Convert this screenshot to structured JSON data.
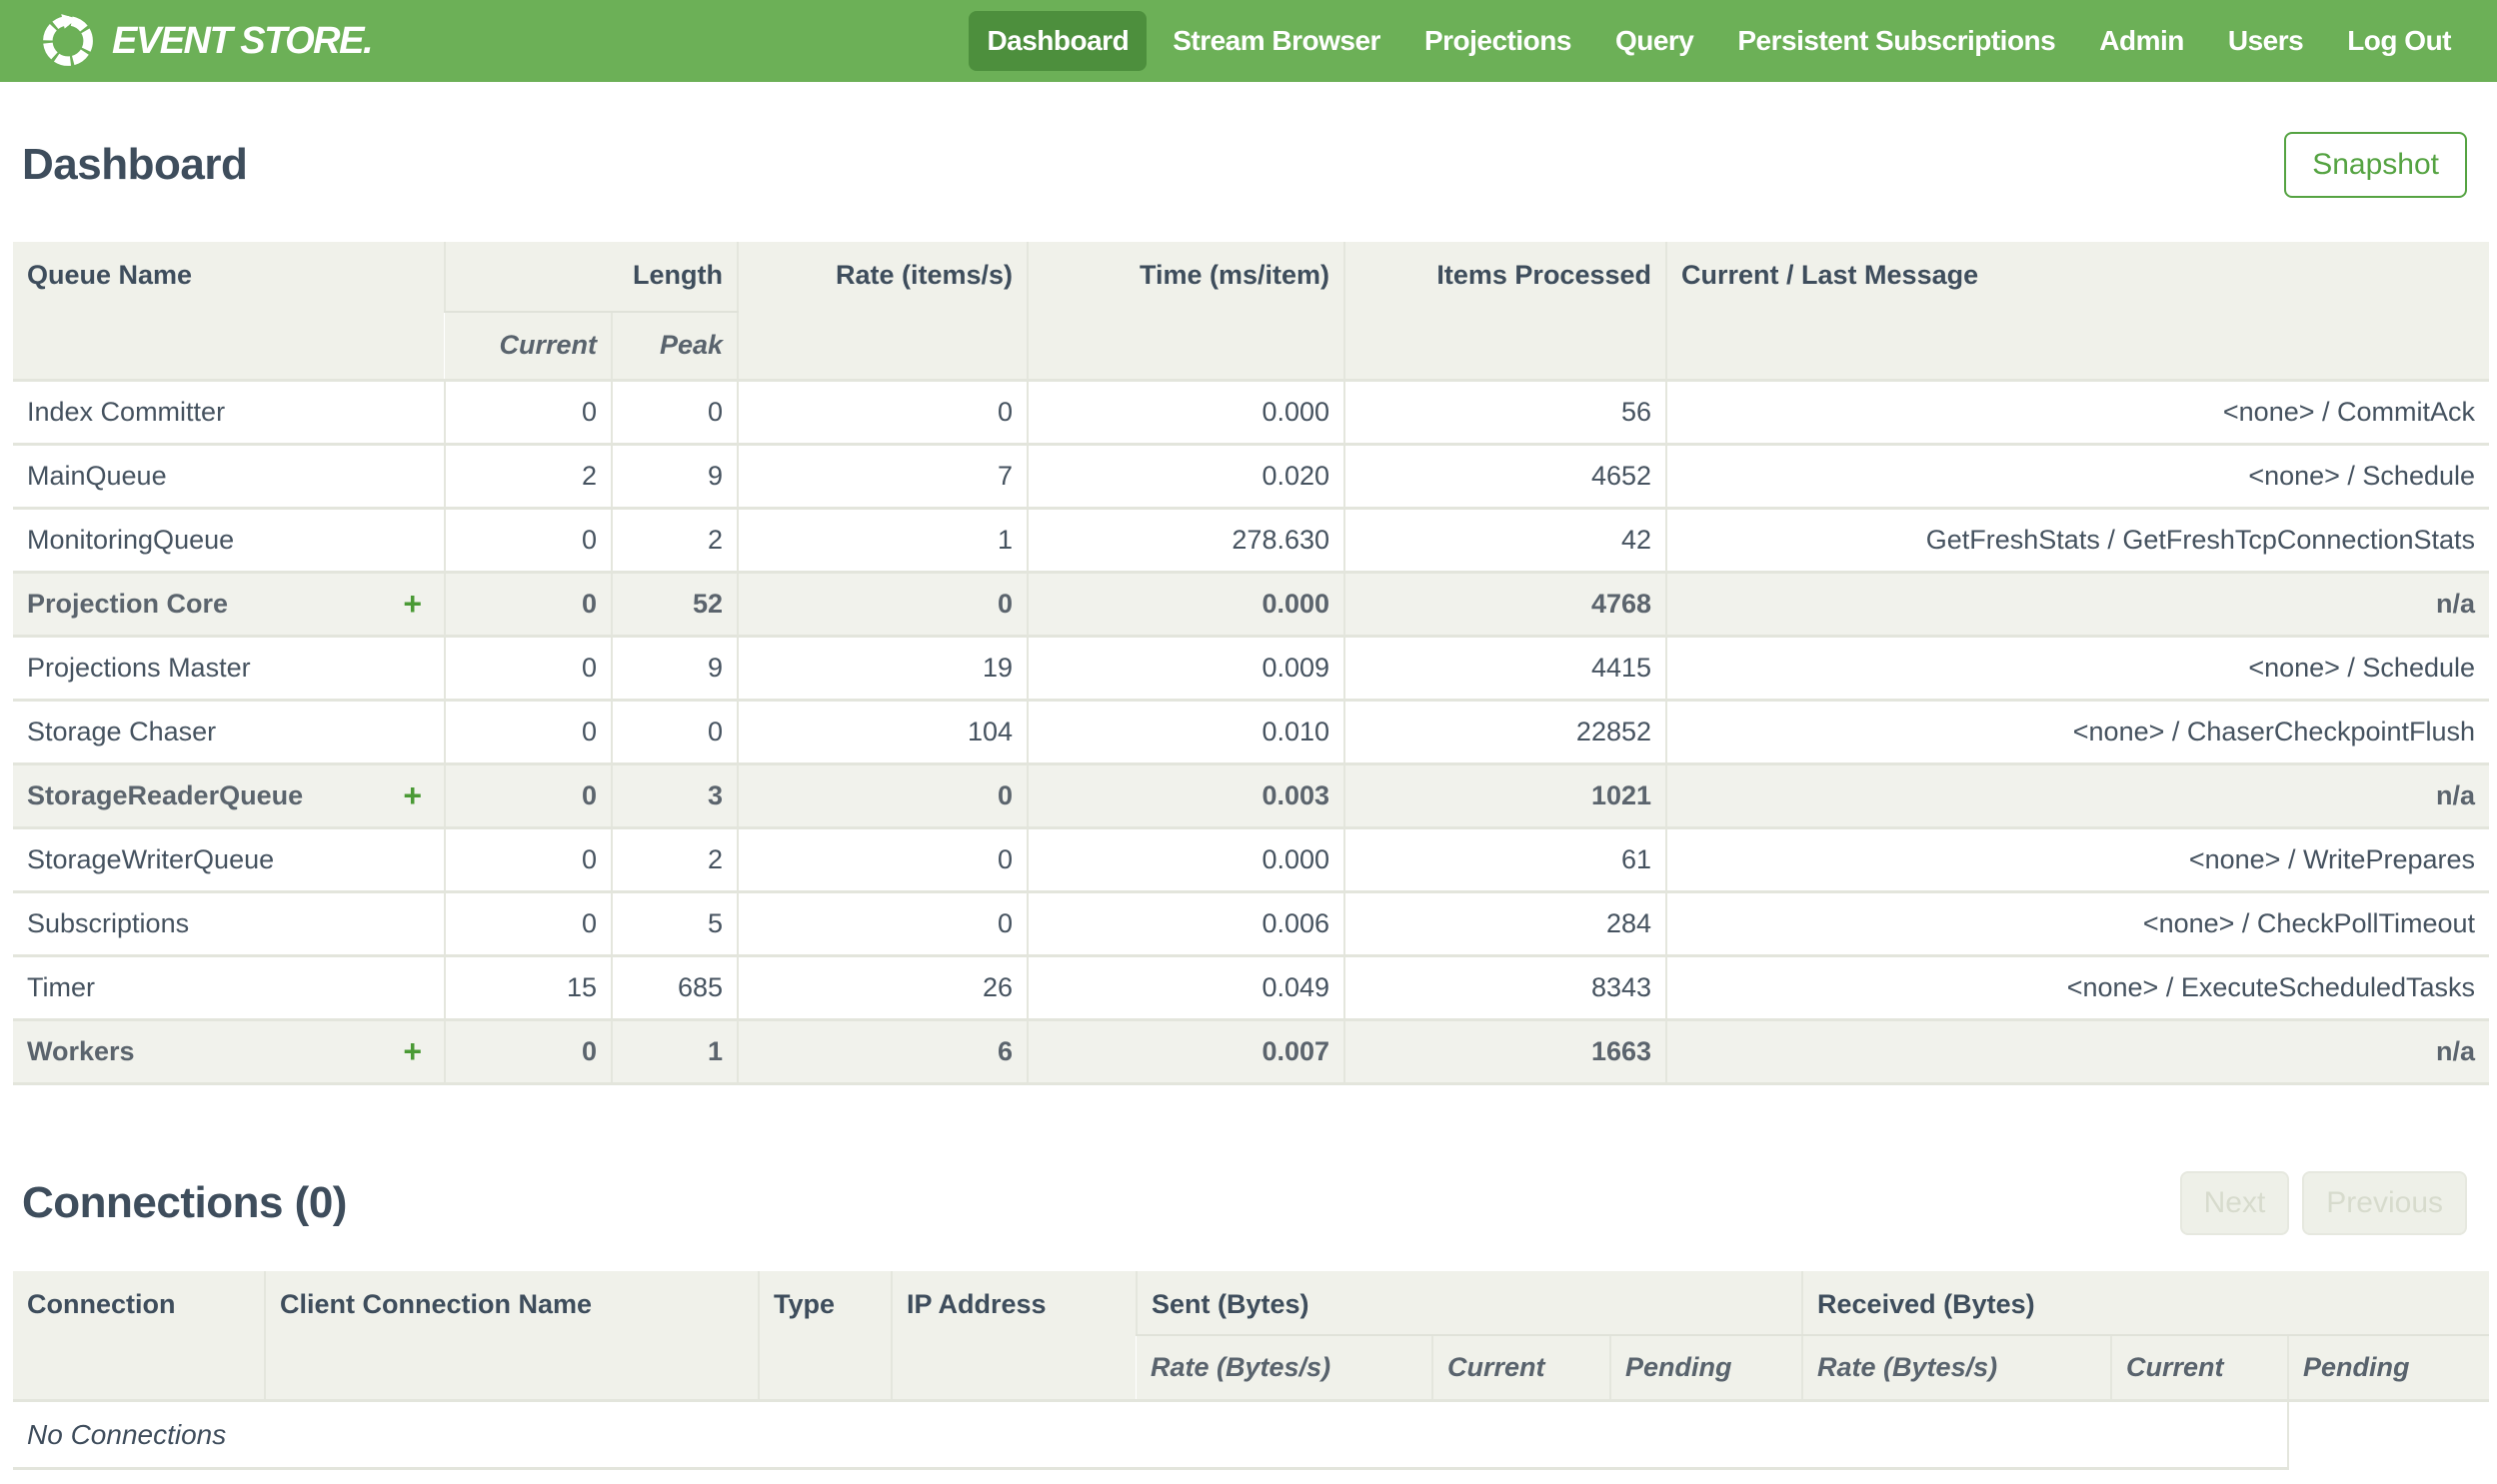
{
  "nav": {
    "brand": "EVENT STORE.",
    "items": [
      {
        "label": "Dashboard",
        "active": true
      },
      {
        "label": "Stream Browser",
        "active": false
      },
      {
        "label": "Projections",
        "active": false
      },
      {
        "label": "Query",
        "active": false
      },
      {
        "label": "Persistent Subscriptions",
        "active": false
      },
      {
        "label": "Admin",
        "active": false
      },
      {
        "label": "Users",
        "active": false
      },
      {
        "label": "Log Out",
        "active": false
      }
    ]
  },
  "header": {
    "title": "Dashboard",
    "snapshot_button": "Snapshot"
  },
  "queues_table": {
    "columns": {
      "queue_name": "Queue Name",
      "length": "Length",
      "current": "Current",
      "peak": "Peak",
      "rate": "Rate (items/s)",
      "time": "Time (ms/item)",
      "items_processed": "Items Processed",
      "message": "Current / Last Message"
    },
    "expand_icon": "+",
    "rows": [
      {
        "name": "Index Committer",
        "group": false,
        "current": "0",
        "peak": "0",
        "rate": "0",
        "time": "0.000",
        "processed": "56",
        "message": "<none> / CommitAck"
      },
      {
        "name": "MainQueue",
        "group": false,
        "current": "2",
        "peak": "9",
        "rate": "7",
        "time": "0.020",
        "processed": "4652",
        "message": "<none> / Schedule"
      },
      {
        "name": "MonitoringQueue",
        "group": false,
        "current": "0",
        "peak": "2",
        "rate": "1",
        "time": "278.630",
        "processed": "42",
        "message": "GetFreshStats / GetFreshTcpConnectionStats"
      },
      {
        "name": "Projection Core",
        "group": true,
        "current": "0",
        "peak": "52",
        "rate": "0",
        "time": "0.000",
        "processed": "4768",
        "message": "n/a"
      },
      {
        "name": "Projections Master",
        "group": false,
        "current": "0",
        "peak": "9",
        "rate": "19",
        "time": "0.009",
        "processed": "4415",
        "message": "<none> / Schedule"
      },
      {
        "name": "Storage Chaser",
        "group": false,
        "current": "0",
        "peak": "0",
        "rate": "104",
        "time": "0.010",
        "processed": "22852",
        "message": "<none> / ChaserCheckpointFlush"
      },
      {
        "name": "StorageReaderQueue",
        "group": true,
        "current": "0",
        "peak": "3",
        "rate": "0",
        "time": "0.003",
        "processed": "1021",
        "message": "n/a"
      },
      {
        "name": "StorageWriterQueue",
        "group": false,
        "current": "0",
        "peak": "2",
        "rate": "0",
        "time": "0.000",
        "processed": "61",
        "message": "<none> / WritePrepares"
      },
      {
        "name": "Subscriptions",
        "group": false,
        "current": "0",
        "peak": "5",
        "rate": "0",
        "time": "0.006",
        "processed": "284",
        "message": "<none> / CheckPollTimeout"
      },
      {
        "name": "Timer",
        "group": false,
        "current": "15",
        "peak": "685",
        "rate": "26",
        "time": "0.049",
        "processed": "8343",
        "message": "<none> / ExecuteScheduledTasks"
      },
      {
        "name": "Workers",
        "group": true,
        "current": "0",
        "peak": "1",
        "rate": "6",
        "time": "0.007",
        "processed": "1663",
        "message": "n/a"
      }
    ]
  },
  "connections": {
    "title": "Connections (0)",
    "next_button": "Next",
    "previous_button": "Previous",
    "columns": {
      "connection": "Connection",
      "client_name": "Client Connection Name",
      "type": "Type",
      "ip": "IP Address",
      "sent": "Sent (Bytes)",
      "received": "Received (Bytes)",
      "rate": "Rate (Bytes/s)",
      "current": "Current",
      "pending": "Pending"
    },
    "empty_message": "No Connections"
  }
}
